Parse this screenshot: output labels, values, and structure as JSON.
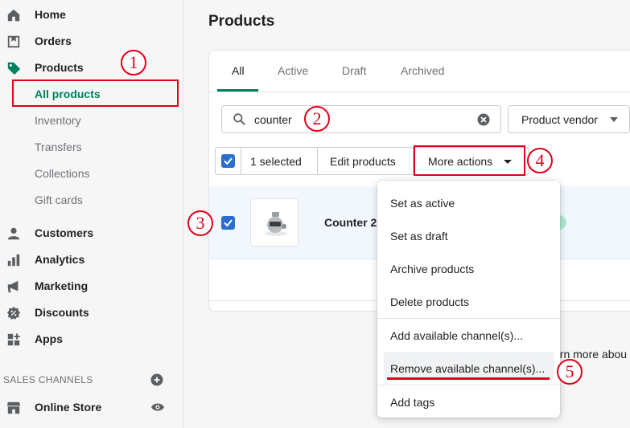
{
  "sidebar": {
    "main_items": [
      {
        "label": "Home",
        "icon": "home-icon"
      },
      {
        "label": "Orders",
        "icon": "orders-icon"
      },
      {
        "label": "Products",
        "icon": "tag-icon"
      }
    ],
    "sub_items": [
      {
        "label": "All products"
      },
      {
        "label": "Inventory"
      },
      {
        "label": "Transfers"
      },
      {
        "label": "Collections"
      },
      {
        "label": "Gift cards"
      }
    ],
    "lower_items": [
      {
        "label": "Customers",
        "icon": "person-icon"
      },
      {
        "label": "Analytics",
        "icon": "bar-chart-icon"
      },
      {
        "label": "Marketing",
        "icon": "megaphone-icon"
      },
      {
        "label": "Discounts",
        "icon": "discount-icon"
      },
      {
        "label": "Apps",
        "icon": "apps-icon"
      }
    ],
    "sales_channels_label": "SALES CHANNELS",
    "online_store": "Online Store"
  },
  "page": {
    "title": "Products"
  },
  "tabs": [
    "All",
    "Active",
    "Draft",
    "Archived"
  ],
  "search": {
    "value": "counter"
  },
  "vendor_filter": {
    "label": "Product vendor"
  },
  "bulk": {
    "selected": "1 selected",
    "edit": "Edit products",
    "more": "More actions"
  },
  "product": {
    "name": "Counter 2"
  },
  "menu": {
    "items": [
      "Set as active",
      "Set as draft",
      "Archive products",
      "Delete products",
      "Add available channel(s)...",
      "Remove available channel(s)...",
      "Add tags"
    ]
  },
  "learn_more": "arn more abou",
  "annotations": [
    "1",
    "2",
    "3",
    "4",
    "5"
  ],
  "colors": {
    "accent": "#008060",
    "annotation": "#e0001a",
    "checkbox": "#2c6ecb"
  }
}
